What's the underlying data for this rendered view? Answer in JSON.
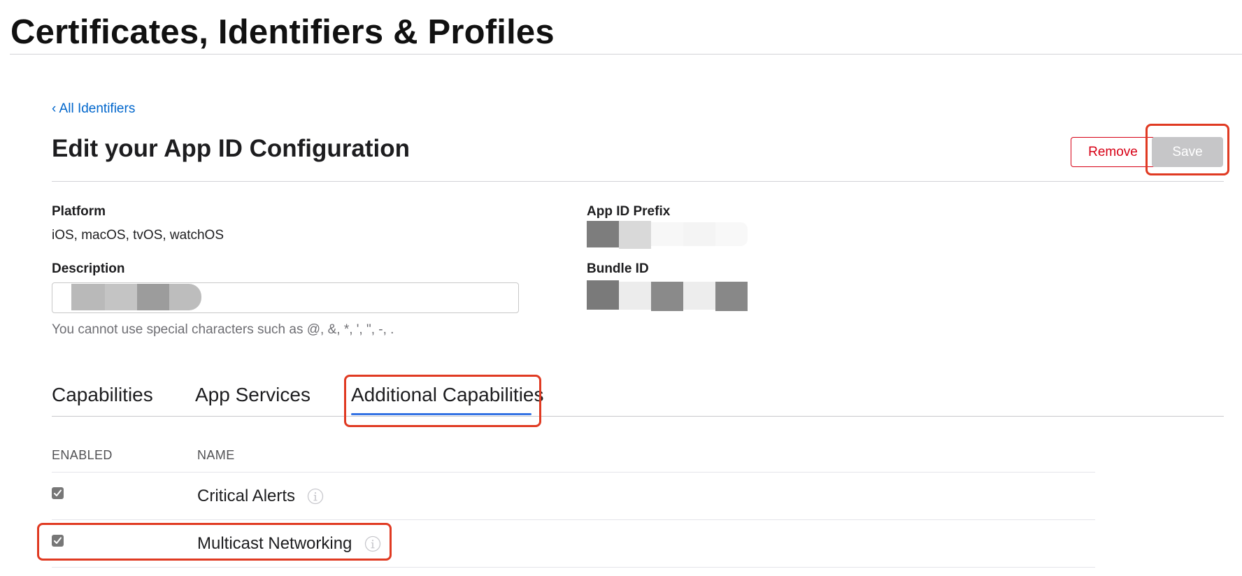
{
  "header": {
    "title": "Certificates, Identifiers & Profiles"
  },
  "nav": {
    "back_label": "‹ All Identifiers"
  },
  "page": {
    "heading": "Edit your App ID Configuration"
  },
  "actions": {
    "remove_label": "Remove",
    "save_label": "Save"
  },
  "fields": {
    "platform_label": "Platform",
    "platform_value": "iOS, macOS, tvOS, watchOS",
    "description_label": "Description",
    "description_hint": "You cannot use special characters such as @, &, *, ', \", -, .",
    "app_id_prefix_label": "App ID Prefix",
    "bundle_id_label": "Bundle ID"
  },
  "tabs": [
    {
      "label": "Capabilities",
      "selected": false
    },
    {
      "label": "App Services",
      "selected": false
    },
    {
      "label": "Additional Capabilities",
      "selected": true
    }
  ],
  "table": {
    "columns": [
      "ENABLED",
      "NAME"
    ],
    "rows": [
      {
        "name": "Critical Alerts",
        "enabled": true,
        "info_icon": "info-icon"
      },
      {
        "name": "Multicast Networking",
        "enabled": true,
        "info_icon": "info-icon"
      }
    ]
  },
  "colors": {
    "link": "#0066cc",
    "danger": "#d70015",
    "save_disabled": "#c6c6c8",
    "tab_accent": "#3573e4",
    "annotation": "#e03a22"
  }
}
